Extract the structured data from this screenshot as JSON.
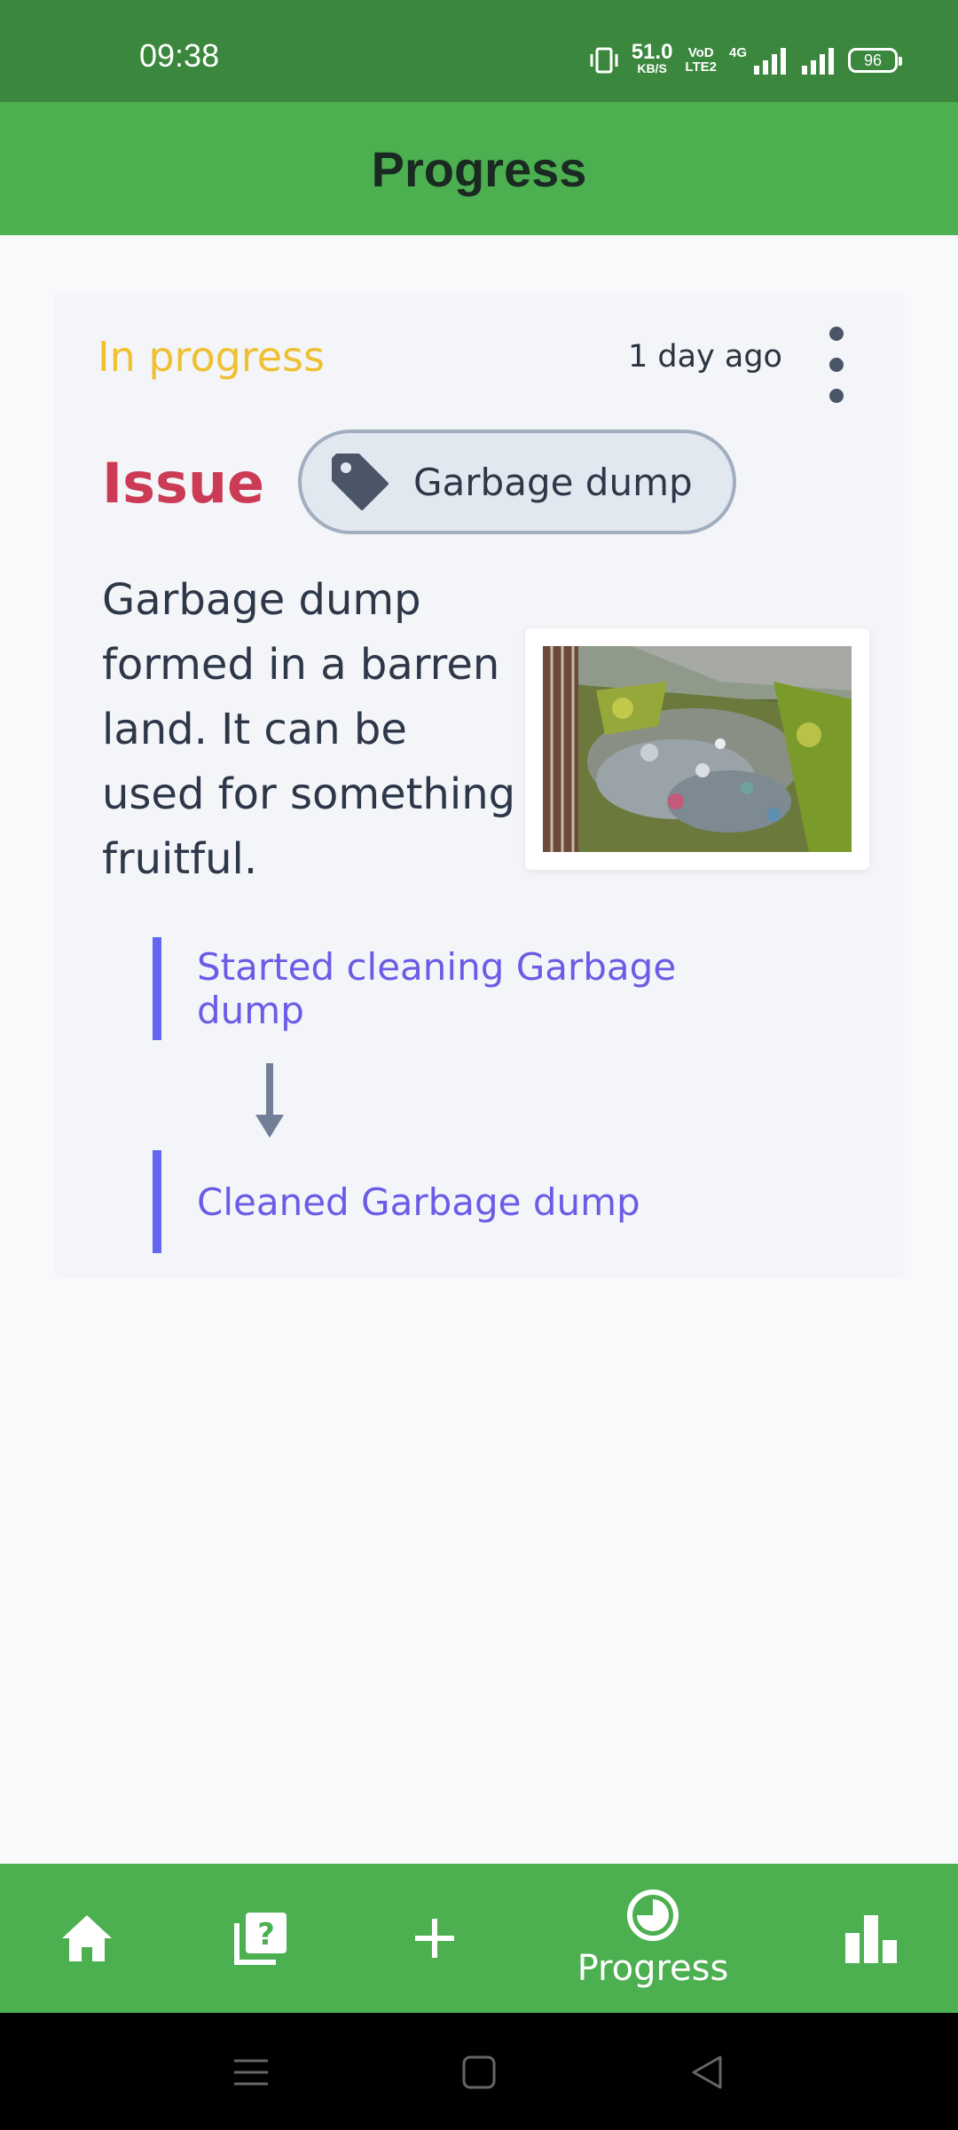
{
  "status_bar": {
    "time": "09:38",
    "net_speed_value": "51.0",
    "net_speed_unit": "KB/S",
    "volte_top": "VoD",
    "volte_bottom": "LTE2",
    "network_type": "4G",
    "battery": "96",
    "icons": [
      "vibrate-icon",
      "signal-icon",
      "signal-icon",
      "battery-icon"
    ]
  },
  "app_bar": {
    "title": "Progress"
  },
  "card": {
    "status": "In progress",
    "time_ago": "1 day ago",
    "issue_label": "Issue",
    "tag": "Garbage dump",
    "description": "Garbage dump formed in a barren land. It can be used for something fruitful.",
    "steps": [
      {
        "label": "Started cleaning Garbage dump"
      },
      {
        "label": "Cleaned Garbage dump"
      }
    ]
  },
  "bottom_nav": {
    "items": [
      {
        "icon": "home-icon"
      },
      {
        "icon": "question-icon"
      },
      {
        "icon": "plus-icon"
      },
      {
        "icon": "progress-icon",
        "label": "Progress",
        "active": true
      },
      {
        "icon": "bar-chart-icon"
      }
    ]
  },
  "colors": {
    "status_bar": "#3b873e",
    "app_bar": "#4caf50",
    "in_progress": "#f0c030",
    "issue": "#cc3b55",
    "step_accent": "#6366f1",
    "step_text": "#6b5ce7"
  }
}
